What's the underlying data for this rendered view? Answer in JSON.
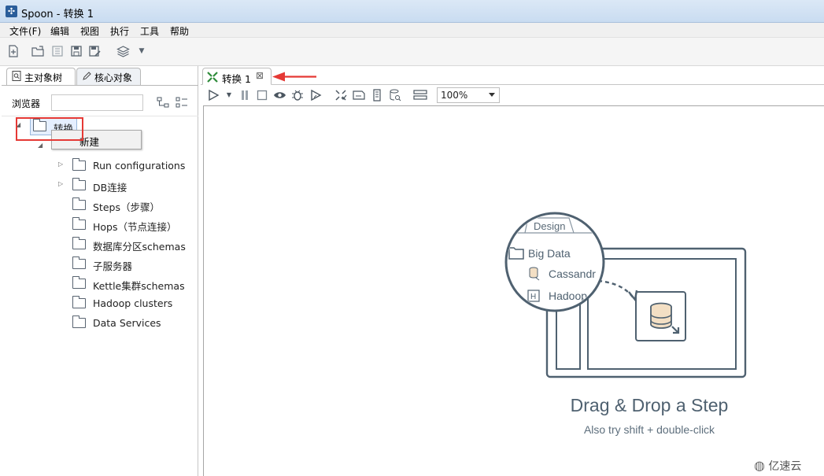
{
  "window": {
    "title": "Spoon - 转换 1"
  },
  "menu": [
    "文件(F)",
    "编辑",
    "视图",
    "执行",
    "工具",
    "帮助"
  ],
  "toolbar": {
    "icons": [
      "new-file-icon",
      "open-folder-icon",
      "explorer-icon",
      "save-icon",
      "save-as-icon",
      "layers-icon",
      "dropdown-caret-icon"
    ]
  },
  "left_panel": {
    "tabs": [
      {
        "label": "主对象树",
        "icon": "search-doc-icon",
        "active": true
      },
      {
        "label": "核心对象",
        "icon": "pencil-icon",
        "active": false
      }
    ],
    "browse_label": "浏览器",
    "search_value": "",
    "root_label": "转换",
    "context_menu_item": "新建",
    "tree_items": [
      {
        "label": "Run configurations",
        "expandable": true
      },
      {
        "label": "DB连接",
        "expandable": true
      },
      {
        "label": "Steps（步骤）",
        "expandable": false
      },
      {
        "label": "Hops（节点连接）",
        "expandable": false
      },
      {
        "label": "数据库分区schemas",
        "expandable": false
      },
      {
        "label": "子服务器",
        "expandable": false
      },
      {
        "label": "Kettle集群schemas",
        "expandable": false
      },
      {
        "label": "Hadoop clusters",
        "expandable": false
      },
      {
        "label": "Data Services",
        "expandable": false
      }
    ]
  },
  "editor": {
    "tab_label": "转换 1",
    "zoom": "100%",
    "canvas_icons": [
      "run-icon",
      "run-options-caret-icon",
      "pause-icon",
      "stop-icon",
      "preview-icon",
      "debug-icon",
      "replay-icon",
      "verify-icon",
      "impact-icon",
      "sql-icon",
      "explore-db-icon",
      "align-icon"
    ]
  },
  "illustration": {
    "design_tab": "Design",
    "category": "Big Data",
    "items": [
      "Cassandr",
      "Hadoop"
    ],
    "item_badge": "H",
    "headline": "Drag & Drop a Step",
    "subline": "Also try shift + double-click"
  },
  "watermark": "亿速云",
  "colors": {
    "annotation_red": "#e53935",
    "illustration_stroke": "#4f6170",
    "titlebar": "#c9dcf1"
  }
}
